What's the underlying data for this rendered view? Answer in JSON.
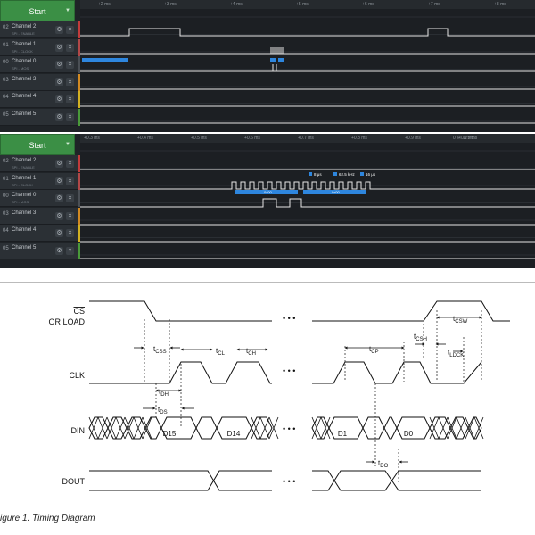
{
  "panel_a": {
    "start_label": "Start",
    "ruler_ticks": [
      "+2 ms",
      "+3 ms",
      "+4 ms",
      "+5 ms",
      "+6 ms",
      "+7 ms",
      "+8 ms"
    ],
    "channels": [
      {
        "num": "02",
        "name": "Channel 2",
        "sub": "SPI - ENABLE",
        "stripe": "#c23b3b"
      },
      {
        "num": "01",
        "name": "Channel 1",
        "sub": "SPI - CLOCK",
        "stripe": "#b14848"
      },
      {
        "num": "00",
        "name": "Channel 0",
        "sub": "SPI - MOSI",
        "stripe": "#4a4f55"
      },
      {
        "num": "03",
        "name": "Channel 3",
        "sub": "",
        "stripe": "#d28a22"
      },
      {
        "num": "04",
        "name": "Channel 4",
        "sub": "",
        "stripe": "#d2b122"
      },
      {
        "num": "05",
        "name": "Channel 5",
        "sub": "",
        "stripe": "#4a9a3a"
      }
    ]
  },
  "panel_b": {
    "start_label": "Start",
    "ruler_ticks": [
      "+0.3 ms",
      "+0.4 ms",
      "+0.5 ms",
      "+0.6 ms",
      "+0.7 ms",
      "+0.8 ms",
      "+0.9 ms",
      "+0.1 ms"
    ],
    "cursor_label": "0 s : 175 ms",
    "measure": [
      "8 μs",
      "62.5 kHz",
      "16 μs"
    ],
    "bus_labels": [
      "0x00",
      "0x00"
    ],
    "channels": [
      {
        "num": "02",
        "name": "Channel 2",
        "sub": "SPI - ENABLE",
        "stripe": "#c23b3b"
      },
      {
        "num": "01",
        "name": "Channel 1",
        "sub": "SPI - CLOCK",
        "stripe": "#b14848"
      },
      {
        "num": "00",
        "name": "Channel 0",
        "sub": "SPI - MOSI",
        "stripe": "#4a4f55"
      },
      {
        "num": "03",
        "name": "Channel 3",
        "sub": "",
        "stripe": "#d28a22"
      },
      {
        "num": "04",
        "name": "Channel 4",
        "sub": "",
        "stripe": "#d2b122"
      },
      {
        "num": "05",
        "name": "Channel 5",
        "sub": "",
        "stripe": "#4a9a3a"
      }
    ]
  },
  "timing": {
    "signal_labels": [
      "CS",
      "OR LOAD",
      "CLK",
      "DIN",
      "DOUT"
    ],
    "param_labels": {
      "css": "CSS",
      "cl": "CL",
      "ch": "CH",
      "cp": "CP",
      "csh": "CSH",
      "csw": "CSW",
      "ldck": "LDCK",
      "dh": "DH",
      "ds": "DS",
      "do": "DO"
    },
    "t_letter": "t",
    "data_labels": [
      "D15",
      "D14",
      "D1",
      "D0"
    ],
    "ellipsis": "• • •"
  },
  "caption": "igure 1. Timing Diagram",
  "colors": {
    "panel_bg": "#1f2327",
    "accent_green": "#3b8f45",
    "trace_white": "#e6e6e6",
    "bus_blue": "#2e86de"
  }
}
